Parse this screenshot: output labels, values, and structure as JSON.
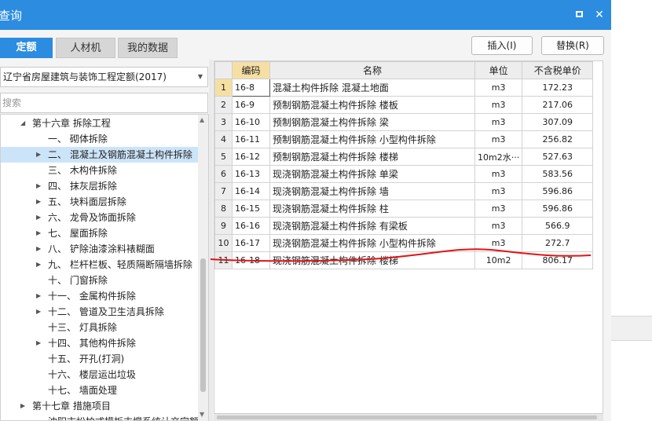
{
  "window": {
    "title": "查询"
  },
  "tabs": [
    {
      "label": "定额",
      "active": true
    },
    {
      "label": "人材机",
      "active": false
    },
    {
      "label": "我的数据",
      "active": false
    }
  ],
  "buttons": {
    "insert": "插入(I)",
    "replace": "替换(R)"
  },
  "dropdown": {
    "value": "辽宁省房屋建筑与装饰工程定额(2017)"
  },
  "search": {
    "placeholder": "搜索"
  },
  "tree": [
    {
      "label": "第十六章  拆除工程",
      "level": 0,
      "expander": "expanded",
      "selected": false
    },
    {
      "label": "一、  砌体拆除",
      "level": 1,
      "expander": "none",
      "selected": false
    },
    {
      "label": "二、  混凝土及钢筋混凝土构件拆除",
      "level": 1,
      "expander": "collapsed",
      "selected": true
    },
    {
      "label": "三、  木构件拆除",
      "level": 1,
      "expander": "none",
      "selected": false
    },
    {
      "label": "四、  抹灰层拆除",
      "level": 1,
      "expander": "collapsed",
      "selected": false
    },
    {
      "label": "五、  块料面层拆除",
      "level": 1,
      "expander": "collapsed",
      "selected": false
    },
    {
      "label": "六、  龙骨及饰面拆除",
      "level": 1,
      "expander": "collapsed",
      "selected": false
    },
    {
      "label": "七、  屋面拆除",
      "level": 1,
      "expander": "collapsed",
      "selected": false
    },
    {
      "label": "八、  铲除油漆涂料裱糊面",
      "level": 1,
      "expander": "collapsed",
      "selected": false
    },
    {
      "label": "九、  栏杆栏板、轻质隔断隔墙拆除",
      "level": 1,
      "expander": "collapsed",
      "selected": false
    },
    {
      "label": "十、  门窗拆除",
      "level": 1,
      "expander": "none",
      "selected": false
    },
    {
      "label": "十一、  金属构件拆除",
      "level": 1,
      "expander": "collapsed",
      "selected": false
    },
    {
      "label": "十二、  管道及卫生洁具拆除",
      "level": 1,
      "expander": "collapsed",
      "selected": false
    },
    {
      "label": "十三、  灯具拆除",
      "level": 1,
      "expander": "none",
      "selected": false
    },
    {
      "label": "十四、  其他构件拆除",
      "level": 1,
      "expander": "collapsed",
      "selected": false
    },
    {
      "label": "十五、  开孔(打洞)",
      "level": 1,
      "expander": "none",
      "selected": false
    },
    {
      "label": "十六、  楼层运出垃圾",
      "level": 1,
      "expander": "none",
      "selected": false
    },
    {
      "label": "十七、  墙面处理",
      "level": 1,
      "expander": "none",
      "selected": false
    },
    {
      "label": "第十七章  措施项目",
      "level": 0,
      "expander": "collapsed",
      "selected": false
    },
    {
      "label": "沈阳市松柏式模板支撑系统计交定额",
      "level": 1,
      "expander": "none",
      "selected": false
    }
  ],
  "grid": {
    "headers": [
      "编码",
      "名称",
      "单位",
      "不含税单价"
    ],
    "rows": [
      {
        "idx": "1",
        "code": "16-8",
        "name": "混凝土构件拆除  混凝土地面",
        "unit": "m3",
        "price": "172.23"
      },
      {
        "idx": "2",
        "code": "16-9",
        "name": "预制钢筋混凝土构件拆除  楼板",
        "unit": "m3",
        "price": "217.06"
      },
      {
        "idx": "3",
        "code": "16-10",
        "name": "预制钢筋混凝土构件拆除  梁",
        "unit": "m3",
        "price": "307.09"
      },
      {
        "idx": "4",
        "code": "16-11",
        "name": "预制钢筋混凝土构件拆除  小型构件拆除",
        "unit": "m3",
        "price": "256.82"
      },
      {
        "idx": "5",
        "code": "16-12",
        "name": "预制钢筋混凝土构件拆除  楼梯",
        "unit": "10m2水···",
        "price": "527.63"
      },
      {
        "idx": "6",
        "code": "16-13",
        "name": "现浇钢筋混凝土构件拆除  单梁",
        "unit": "m3",
        "price": "583.56"
      },
      {
        "idx": "7",
        "code": "16-14",
        "name": "现浇钢筋混凝土构件拆除  墙",
        "unit": "m3",
        "price": "596.86"
      },
      {
        "idx": "8",
        "code": "16-15",
        "name": "现浇钢筋混凝土构件拆除  柱",
        "unit": "m3",
        "price": "596.86"
      },
      {
        "idx": "9",
        "code": "16-16",
        "name": "现浇钢筋混凝土构件拆除  有梁板",
        "unit": "m3",
        "price": "566.9"
      },
      {
        "idx": "10",
        "code": "16-17",
        "name": "现浇钢筋混凝土构件拆除  小型构件拆除",
        "unit": "m3",
        "price": "272.7"
      },
      {
        "idx": "11",
        "code": "16-18",
        "name": "现浇钢筋混凝土构件拆除  楼梯",
        "unit": "10m2",
        "price": "806.17"
      }
    ]
  },
  "colors": {
    "accent": "#2b8ce0",
    "annotation": "#e21414",
    "selected_row": "#cce4f8",
    "header_highlight": "#f6dfa3"
  }
}
